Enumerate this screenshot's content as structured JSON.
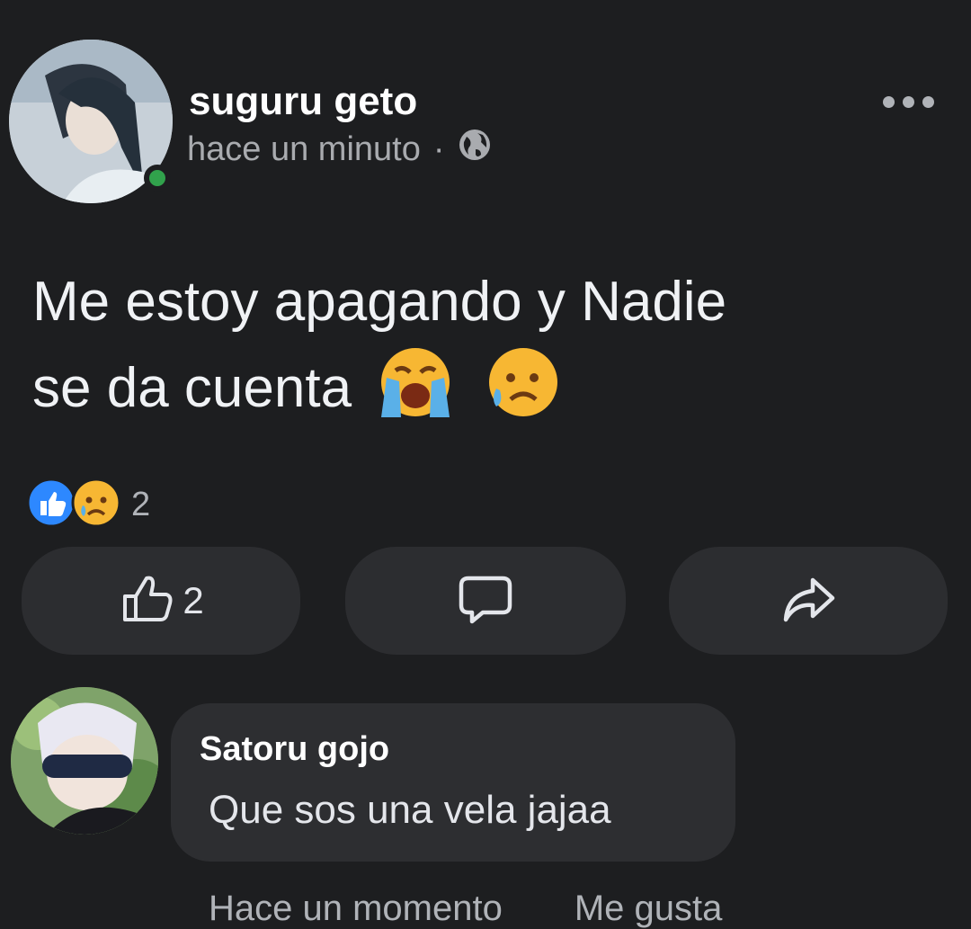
{
  "post": {
    "author": "suguru geto",
    "time": "hace un minuto",
    "separator": "·",
    "privacy_icon": "globe-icon",
    "text_line1": "Me estoy apagando y Nadie",
    "text_line2": "se da cuenta",
    "emojis": [
      "loudly-crying-face",
      "sad-but-relieved-face"
    ],
    "reactions": {
      "icons": [
        "like-reaction-icon",
        "sad-reaction-icon"
      ],
      "count": "2"
    },
    "actions": {
      "like_count": "2",
      "icons": [
        "thumbs-up-icon",
        "comment-icon",
        "share-icon"
      ]
    }
  },
  "comment": {
    "author": "Satoru gojo",
    "text": "Que sos una vela jajaa",
    "time": "Hace un momento",
    "like_label": "Me gusta"
  },
  "colors": {
    "background": "#1d1e20",
    "button": "#2c2d30",
    "online": "#31a24c",
    "like_blue": "#2d88ff"
  }
}
